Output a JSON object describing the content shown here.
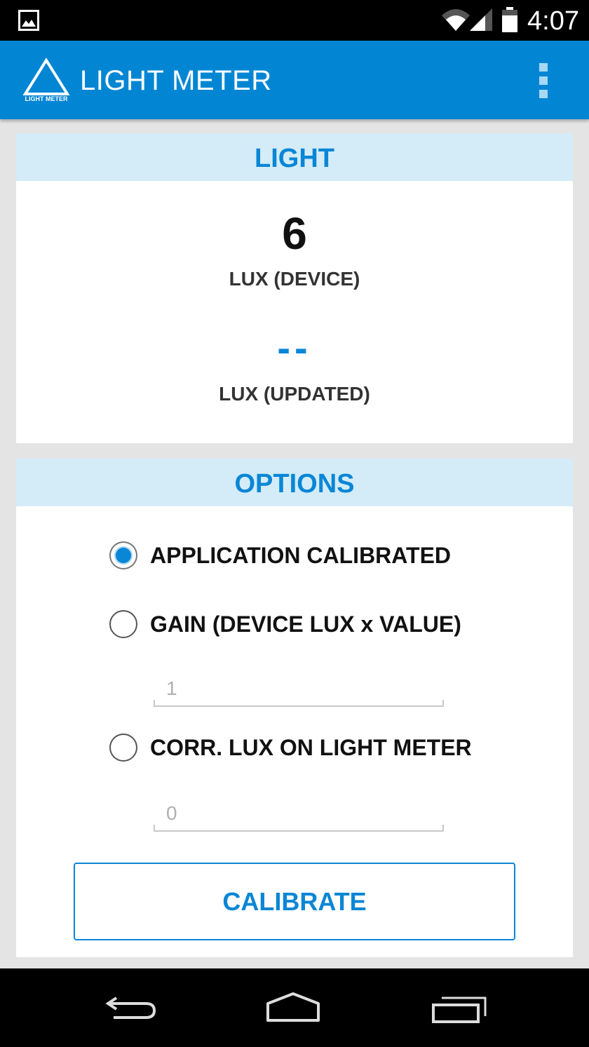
{
  "status_bar": {
    "time": "4:07",
    "icons": [
      "image-icon",
      "wifi-icon",
      "signal-icon",
      "battery-icon"
    ]
  },
  "app_bar": {
    "logo_text": "LIGHT METER",
    "title": "LIGHT METER",
    "overflow_icon": "overflow-menu-icon",
    "color": "#0286d4"
  },
  "light_card": {
    "header": "LIGHT",
    "lux_device_value": "6",
    "lux_device_label": "LUX (DEVICE)",
    "lux_updated_value": "--",
    "lux_updated_label": "LUX (UPDATED)"
  },
  "options_card": {
    "header": "OPTIONS",
    "options": [
      {
        "label": "APPLICATION CALIBRATED",
        "checked": true
      },
      {
        "label": "GAIN (DEVICE LUX x VALUE)",
        "checked": false
      },
      {
        "label": "CORR. LUX ON LIGHT METER",
        "checked": false
      }
    ],
    "gain_value": "1",
    "corr_lux_value": "0",
    "calibrate_label": "CALIBRATE"
  },
  "nav_bar": {
    "icons": [
      "back-icon",
      "home-icon",
      "recents-icon"
    ]
  },
  "colors": {
    "accent": "#0a86d6",
    "header_bg": "#d3ecf8",
    "page_bg": "#e4e4e4"
  }
}
